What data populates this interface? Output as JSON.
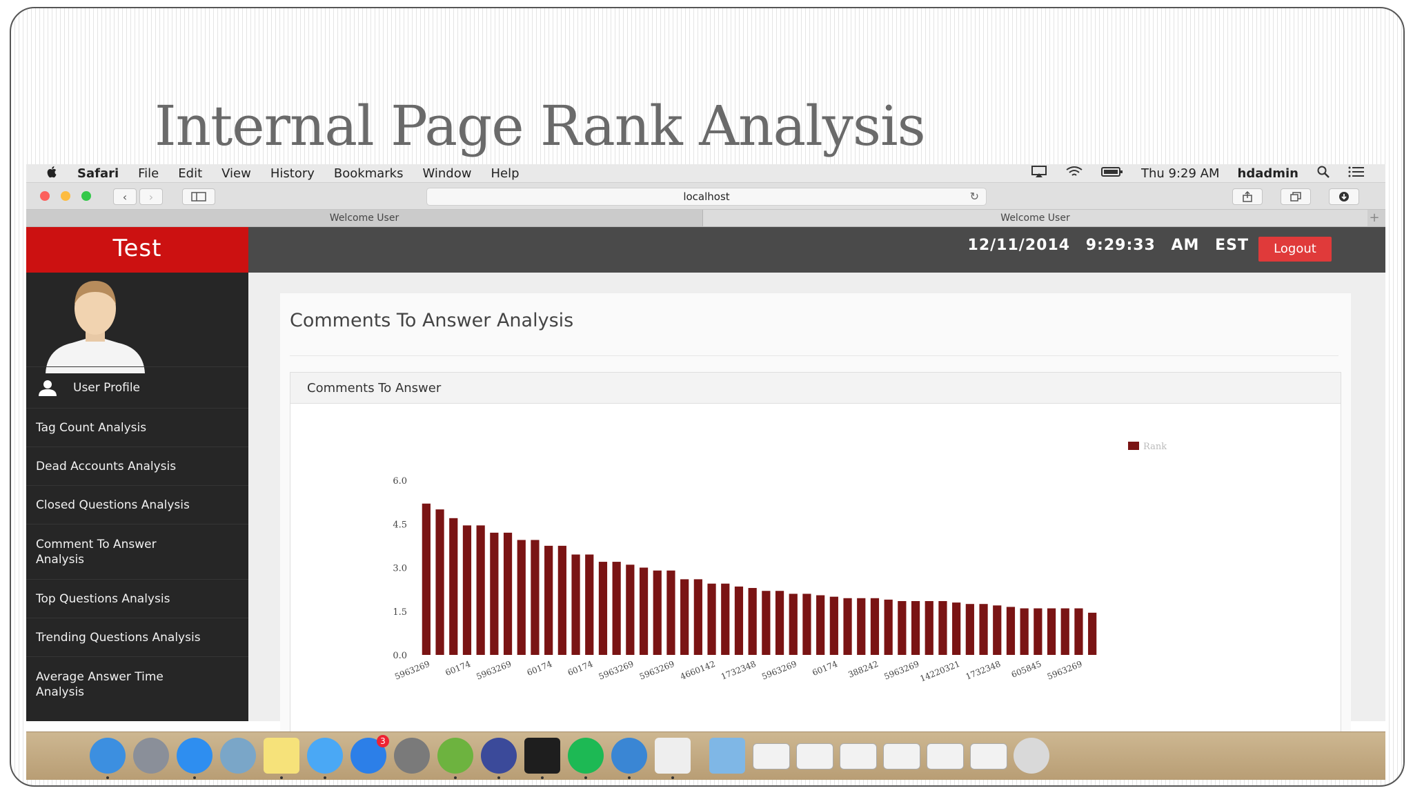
{
  "slide": {
    "title": "Internal Page Rank Analysis"
  },
  "menubar": {
    "app": "Safari",
    "items": [
      "File",
      "Edit",
      "View",
      "History",
      "Bookmarks",
      "Window",
      "Help"
    ],
    "clock": "Thu 9:29 AM",
    "user": "hdadmin",
    "icons": [
      "apple-icon",
      "airplay-icon",
      "wifi-icon",
      "battery-icon",
      "spotlight-icon",
      "notification-list-icon"
    ]
  },
  "toolbar": {
    "url": "localhost",
    "traffic_light_colors": [
      "#fc605c",
      "#fdbc40",
      "#34c84a"
    ]
  },
  "tabs": [
    "Welcome User",
    "Welcome User"
  ],
  "app": {
    "brand": "Test",
    "date": "12/11/2014",
    "time": "9:29:33 AM EST",
    "logout": "Logout",
    "accent_color": "#cc1111"
  },
  "sidebar": {
    "items": [
      {
        "label": "User Profile"
      },
      {
        "label": "Tag Count Analysis"
      },
      {
        "label": "Dead Accounts Analysis"
      },
      {
        "label": "Closed Questions Analysis"
      },
      {
        "label": "Comment To Answer Analysis"
      },
      {
        "label": "Top Questions Analysis"
      },
      {
        "label": "Trending Questions Analysis"
      },
      {
        "label": "Average Answer Time Analysis"
      }
    ]
  },
  "main": {
    "title": "Comments To Answer Analysis",
    "card_title": "Comments To Answer"
  },
  "chart_data": {
    "type": "bar",
    "title": "",
    "xlabel": "",
    "ylabel": "",
    "legend": "Rank",
    "legend_position": "top-right",
    "bar_color": "#7a1414",
    "ylim": [
      0,
      6.0
    ],
    "yticks": [
      "0.0",
      "1.5",
      "3.0",
      "4.5",
      "6.0"
    ],
    "grid": false,
    "values": [
      5.2,
      5.0,
      4.7,
      4.45,
      4.45,
      4.2,
      4.2,
      3.95,
      3.95,
      3.75,
      3.75,
      3.45,
      3.45,
      3.2,
      3.2,
      3.1,
      3.0,
      2.9,
      2.9,
      2.6,
      2.6,
      2.45,
      2.45,
      2.35,
      2.3,
      2.2,
      2.2,
      2.1,
      2.1,
      2.05,
      2.0,
      1.95,
      1.95,
      1.95,
      1.9,
      1.85,
      1.85,
      1.85,
      1.85,
      1.8,
      1.75,
      1.75,
      1.7,
      1.65,
      1.6,
      1.6,
      1.6,
      1.6,
      1.6,
      1.45
    ],
    "tick_labels": [
      "5963269",
      "60174",
      "5963269",
      "60174",
      "60174",
      "5963269",
      "5963269",
      "4660142",
      "1732348",
      "5963269",
      "60174",
      "388242",
      "5963269",
      "14220321",
      "1732348",
      "605845",
      "5963269"
    ]
  },
  "dock": {
    "icons": [
      "finder-icon",
      "launchpad-icon",
      "safari-icon",
      "preview-icon",
      "notes-icon",
      "messages-icon",
      "app-store-icon",
      "system-preferences-icon",
      "spring-leaf-icon",
      "eclipse-icon",
      "terminal-icon",
      "spotify-icon",
      "xcode-icon",
      "textedit-icon",
      "documents-folder-icon",
      "window-thumb-1-icon",
      "window-thumb-2-icon",
      "window-thumb-3-icon",
      "window-thumb-4-icon",
      "window-thumb-5-icon",
      "window-thumb-6-icon",
      "trash-icon"
    ],
    "app_store_badge": "3"
  }
}
